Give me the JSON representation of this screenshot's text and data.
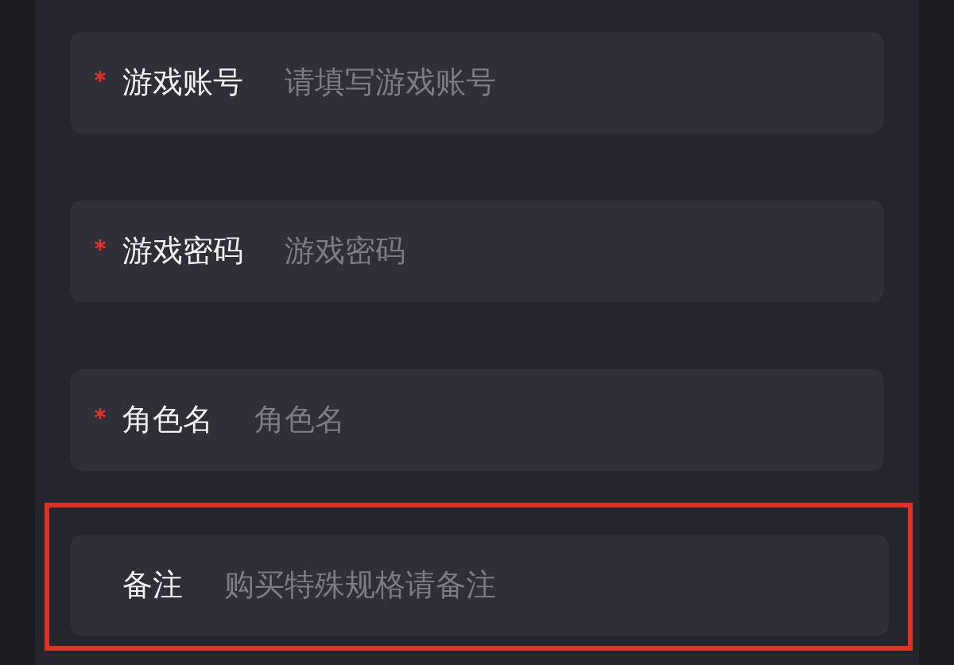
{
  "fields": [
    {
      "label": "游戏账号",
      "placeholder": "请填写游戏账号",
      "required": true,
      "highlighted": false
    },
    {
      "label": "游戏密码",
      "placeholder": "游戏密码",
      "required": true,
      "highlighted": false
    },
    {
      "label": "角色名",
      "placeholder": "角色名",
      "required": true,
      "highlighted": false
    },
    {
      "label": "备注",
      "placeholder": "购买特殊规格请备注",
      "required": false,
      "highlighted": true
    }
  ]
}
